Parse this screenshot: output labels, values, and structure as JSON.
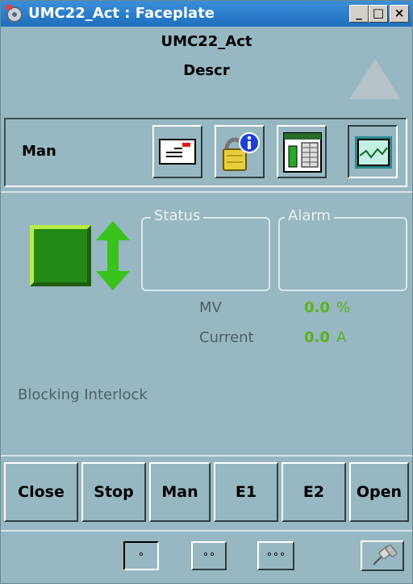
{
  "window": {
    "title": "UMC22_Act : Faceplate",
    "controls": {
      "minimize": "_",
      "maximize": "□",
      "close": "×"
    }
  },
  "header": {
    "tag_name": "UMC22_Act",
    "description": "Descr"
  },
  "toolbar": {
    "mode": "Man",
    "buttons": [
      "message-icon",
      "info-lock-icon",
      "trend-table-icon",
      "trend-chart-icon"
    ]
  },
  "status": {
    "status_title": "Status",
    "alarm_title": "Alarm",
    "mv_label": "MV",
    "mv_value": "0.0",
    "mv_unit": "%",
    "current_label": "Current",
    "current_value": "0.0",
    "current_unit": "A",
    "interlock_text": "Blocking Interlock"
  },
  "commands": [
    "Close",
    "Stop",
    "Man",
    "E1",
    "E2",
    "Open"
  ],
  "footer": {
    "view_buttons": [
      "∘",
      "∘∘",
      "∘∘∘"
    ]
  },
  "colors": {
    "panel": "#97b7c2",
    "titlebar": "#2a7fd0",
    "motor_green": "#228a14",
    "value_green": "#59b31a"
  }
}
